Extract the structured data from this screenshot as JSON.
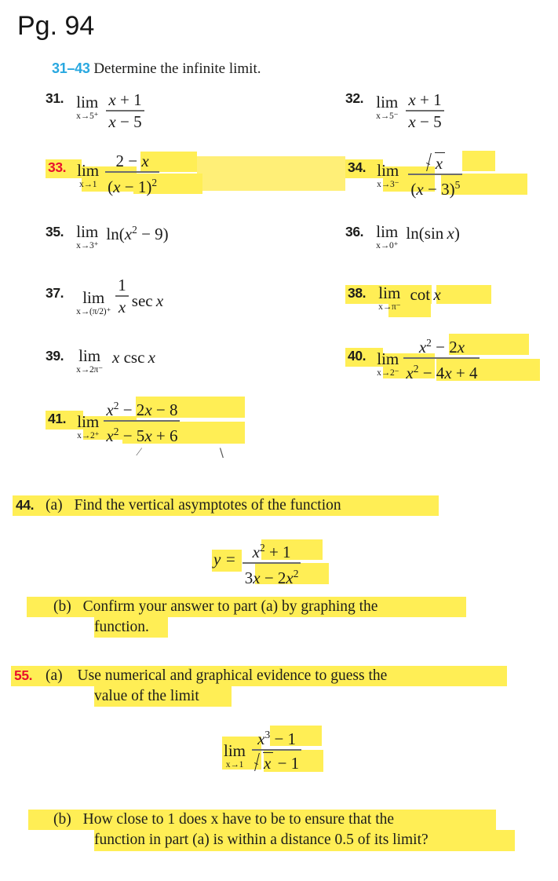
{
  "page": {
    "title": "Pg. 94",
    "colors": {
      "highlight_yellow": "#ffee55",
      "highlight_pale": "#ffef77",
      "range_blue": "#29a8e0",
      "number_red": "#e8112d",
      "text_black": "#1d1d1b",
      "background": "#ffffff"
    }
  },
  "section": {
    "range": "31–43",
    "instruction": "Determine the infinite limit."
  },
  "problems": [
    {
      "number": "31.",
      "limit_op": "lim",
      "limit_sub": "x→5⁺",
      "numerator": "x + 1",
      "denominator": "x − 5",
      "highlighted": false
    },
    {
      "number": "32.",
      "limit_op": "lim",
      "limit_sub": "x→5⁻",
      "numerator": "x + 1",
      "denominator": "x − 5",
      "highlighted": false
    },
    {
      "number": "33.",
      "limit_op": "lim",
      "limit_sub": "x→1",
      "numerator": "2 − x",
      "denominator": "(x − 1)²",
      "highlighted": true,
      "number_color": "red"
    },
    {
      "number": "34.",
      "limit_op": "lim",
      "limit_sub": "x→3⁻",
      "numerator": "√x",
      "denominator": "(x − 3)⁵",
      "highlighted": true
    },
    {
      "number": "35.",
      "limit_op": "lim",
      "limit_sub": "x→3⁺",
      "body": "ln(x² − 9)",
      "highlighted": false
    },
    {
      "number": "36.",
      "limit_op": "lim",
      "limit_sub": "x→0⁺",
      "body": "ln(sin x)",
      "highlighted": false
    },
    {
      "number": "37.",
      "limit_op": "lim",
      "limit_sub": "x→(π/2)⁺",
      "numerator": "1",
      "denominator": "x",
      "trailing": "sec x",
      "highlighted": false
    },
    {
      "number": "38.",
      "limit_op": "lim",
      "limit_sub": "x→π⁻",
      "body": "cot x",
      "highlighted": true
    },
    {
      "number": "39.",
      "limit_op": "lim",
      "limit_sub": "x→2π⁻",
      "body": "x csc x",
      "highlighted": false
    },
    {
      "number": "40.",
      "limit_op": "lim",
      "limit_sub": "x→2⁻",
      "numerator": "x² − 2x",
      "denominator": "x² − 4x + 4",
      "highlighted": true
    },
    {
      "number": "41.",
      "limit_op": "lim",
      "limit_sub": "x→2⁺",
      "numerator": "x² − 2x − 8",
      "denominator": "x² − 5x + 6",
      "highlighted": true
    }
  ],
  "problem44": {
    "number": "44.",
    "part_a_label": "(a)",
    "part_a_text": "Find the vertical asymptotes of the function",
    "equation": {
      "lhs": "y =",
      "numerator": "x² + 1",
      "denominator": "3x − 2x²"
    },
    "part_b_label": "(b)",
    "part_b_line1": "Confirm your answer to part (a) by graphing the",
    "part_b_line2": "function."
  },
  "problem55": {
    "number": "55.",
    "part_a_label": "(a)",
    "part_a_line1": "Use numerical and graphical evidence to guess the",
    "part_a_line2": "value of the limit",
    "limit": {
      "limit_op": "lim",
      "limit_sub": "x→1",
      "numerator": "x³ − 1",
      "denominator": "√x − 1"
    },
    "part_b_label": "(b)",
    "part_b_line1": "How close to 1 does x have to be to ensure that the",
    "part_b_line2": "function in part (a) is within a distance 0.5 of its limit?"
  },
  "marks": {
    "tick_left": "⁄",
    "tick_right": "∖"
  }
}
